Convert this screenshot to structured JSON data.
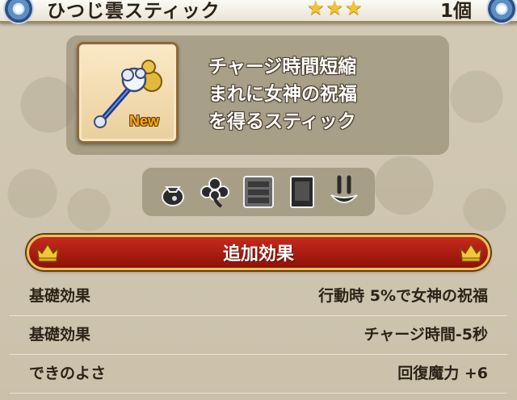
{
  "header": {
    "title": "ひつじ雲スティック",
    "stars": "★★★",
    "count": "1個"
  },
  "item": {
    "icon": "staff-icon",
    "badge": "New",
    "description": [
      "チャージ時間短縮",
      "まれに女神の祝福",
      "を得るスティック"
    ]
  },
  "categories": [
    {
      "icon": "pouch-icon"
    },
    {
      "icon": "clover-icon"
    },
    {
      "icon": "cabinet-icon"
    },
    {
      "icon": "book-icon"
    },
    {
      "icon": "sprout-icon"
    }
  ],
  "effects": {
    "title": "追加効果",
    "rows": [
      {
        "label": "基礎効果",
        "value": "行動時 5%で女神の祝福"
      },
      {
        "label": "基礎効果",
        "value": "チャージ時間-5秒"
      },
      {
        "label": "できのよさ",
        "value": "回復魔力 +6"
      }
    ]
  },
  "colors": {
    "effect_bar": "#b01f14",
    "effect_border": "#e8c25a",
    "star": "#f2c232",
    "new_badge": "#f6a81a"
  }
}
